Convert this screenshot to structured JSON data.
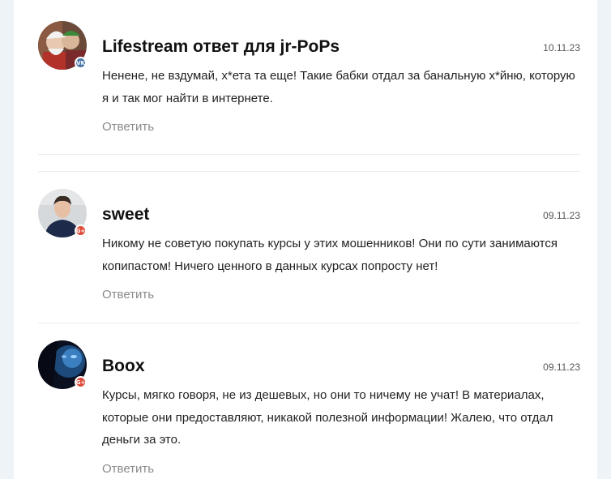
{
  "comments": [
    {
      "author": "Lifestream ответ для jr-PoPs",
      "date": "10.11.23",
      "text": "Ненене, не вздумай, х*ета та еще! Такие бабки отдал за банальную х*йню, которую я и так мог найти в интернете.",
      "reply_label": "Ответить",
      "badge": "VK",
      "badge_icon": "vk-icon"
    },
    {
      "author": "sweet",
      "date": "09.11.23",
      "text": "Никому не советую покупать курсы у этих мошенников! Они по сути занимаются копипастом! Ничего ценного в данных курсах попросту нет!",
      "reply_label": "Ответить",
      "badge": "G+",
      "badge_icon": "google-plus-icon"
    },
    {
      "author": "Boox",
      "date": "09.11.23",
      "text": "Курсы, мягко говоря, не из дешевых, но они то ничему не учат! В материалах, которые они предоставляют, никакой полезной информации! Жалею, что отдал деньги за это.",
      "reply_label": "Ответить",
      "badge": "G+",
      "badge_icon": "google-plus-icon"
    }
  ],
  "colors": {
    "vk": "#4a76a8",
    "google_plus": "#dd4b39",
    "page_background": "#eef3f8",
    "card_background": "#ffffff"
  }
}
